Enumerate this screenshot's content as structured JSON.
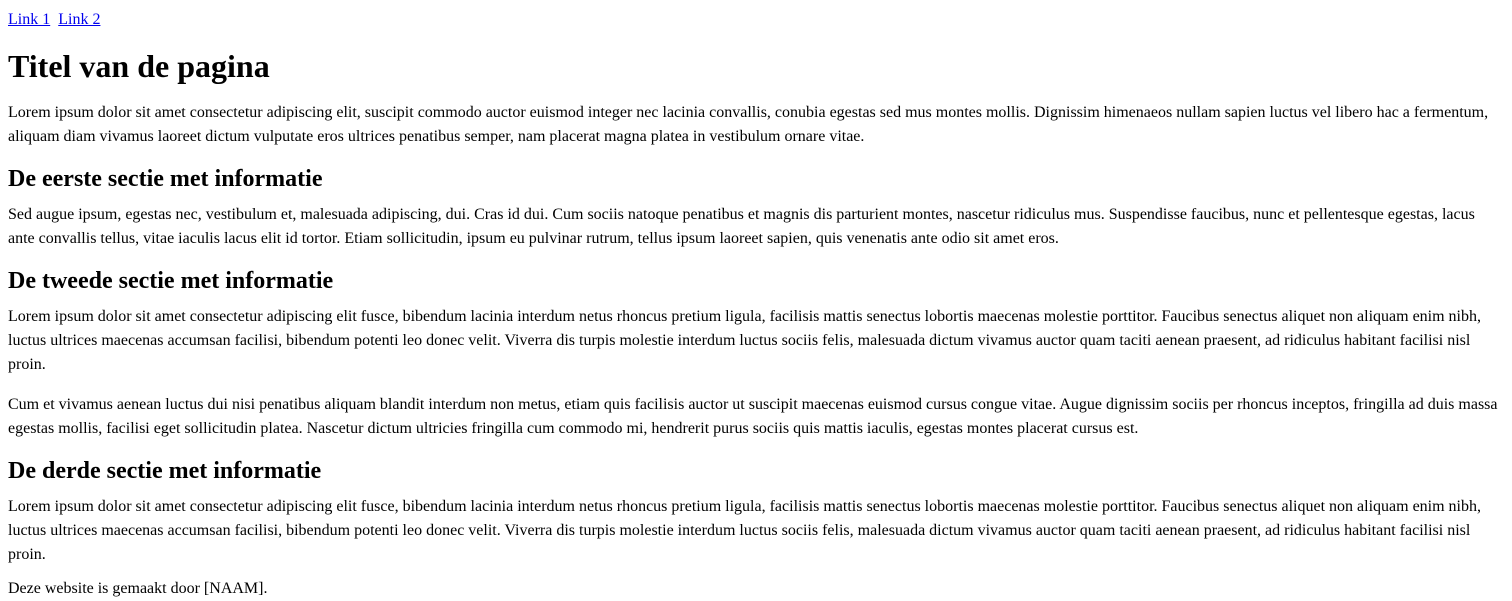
{
  "nav": {
    "links": [
      "Link 1",
      "Link 2"
    ]
  },
  "header": {
    "title": "Titel van de pagina"
  },
  "intro": "Lorem ipsum dolor sit amet consectetur adipiscing elit, suscipit commodo auctor euismod integer nec lacinia convallis, conubia egestas sed mus montes mollis. Dignissim himenaeos nullam sapien luctus vel libero hac a fermentum, aliquam diam vivamus laoreet dictum vulputate eros ultrices penatibus semper, nam placerat magna platea in vestibulum ornare vitae.",
  "sections": [
    {
      "heading": "De eerste sectie met informatie",
      "paragraphs": [
        "Sed augue ipsum, egestas nec, vestibulum et, malesuada adipiscing, dui. Cras id dui. Cum sociis natoque penatibus et magnis dis parturient montes, nascetur ridiculus mus. Suspendisse faucibus, nunc et pellentesque egestas, lacus ante convallis tellus, vitae iaculis lacus elit id tortor. Etiam sollicitudin, ipsum eu pulvinar rutrum, tellus ipsum laoreet sapien, quis venenatis ante odio sit amet eros."
      ]
    },
    {
      "heading": "De tweede sectie met informatie",
      "paragraphs": [
        "Lorem ipsum dolor sit amet consectetur adipiscing elit fusce, bibendum lacinia interdum netus rhoncus pretium ligula, facilisis mattis senectus lobortis maecenas molestie porttitor. Faucibus senectus aliquet non aliquam enim nibh, luctus ultrices maecenas accumsan facilisi, bibendum potenti leo donec velit. Viverra dis turpis molestie interdum luctus sociis felis, malesuada dictum vivamus auctor quam taciti aenean praesent, ad ridiculus habitant facilisi nisl proin.",
        "Cum et vivamus aenean luctus dui nisi penatibus aliquam blandit interdum non metus, etiam quis facilisis auctor ut suscipit maecenas euismod cursus congue vitae. Augue dignissim sociis per rhoncus inceptos, fringilla ad duis massa egestas mollis, facilisi eget sollicitudin platea. Nascetur dictum ultricies fringilla cum commodo mi, hendrerit purus sociis quis mattis iaculis, egestas montes placerat cursus est."
      ]
    },
    {
      "heading": "De derde sectie met informatie",
      "paragraphs": [
        "Lorem ipsum dolor sit amet consectetur adipiscing elit fusce, bibendum lacinia interdum netus rhoncus pretium ligula, facilisis mattis senectus lobortis maecenas molestie porttitor. Faucibus senectus aliquet non aliquam enim nibh, luctus ultrices maecenas accumsan facilisi, bibendum potenti leo donec velit. Viverra dis turpis molestie interdum luctus sociis felis, malesuada dictum vivamus auctor quam taciti aenean praesent, ad ridiculus habitant facilisi nisl proin."
      ]
    }
  ],
  "footer": {
    "text": "Deze website is gemaakt door [NAAM]."
  },
  "colors": {
    "link": "#0000ee",
    "text": "#000000",
    "background": "#ffffff"
  }
}
